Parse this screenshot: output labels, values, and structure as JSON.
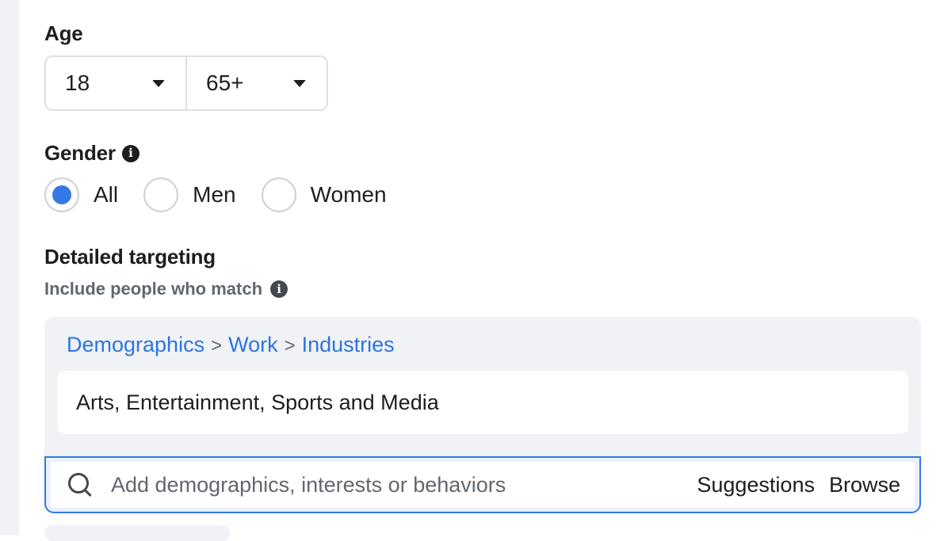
{
  "age": {
    "label": "Age",
    "min_value": "18",
    "max_value": "65+"
  },
  "gender": {
    "label": "Gender",
    "info_icon": "i",
    "options": [
      {
        "label": "All",
        "selected": true
      },
      {
        "label": "Men",
        "selected": false
      },
      {
        "label": "Women",
        "selected": false
      }
    ]
  },
  "detailed_targeting": {
    "label": "Detailed targeting",
    "subtitle": "Include people who match",
    "info_icon": "i",
    "breadcrumb": [
      "Demographics",
      "Work",
      "Industries"
    ],
    "breadcrumb_separator": ">",
    "selected_items": [
      "Arts, Entertainment, Sports and Media"
    ],
    "search": {
      "placeholder": "Add demographics, interests or behaviors",
      "value": "",
      "suggestions_label": "Suggestions",
      "browse_label": "Browse"
    }
  },
  "colors": {
    "accent": "#3578e5",
    "link": "#2d74e2",
    "panel_bg": "#f0f2f5"
  }
}
